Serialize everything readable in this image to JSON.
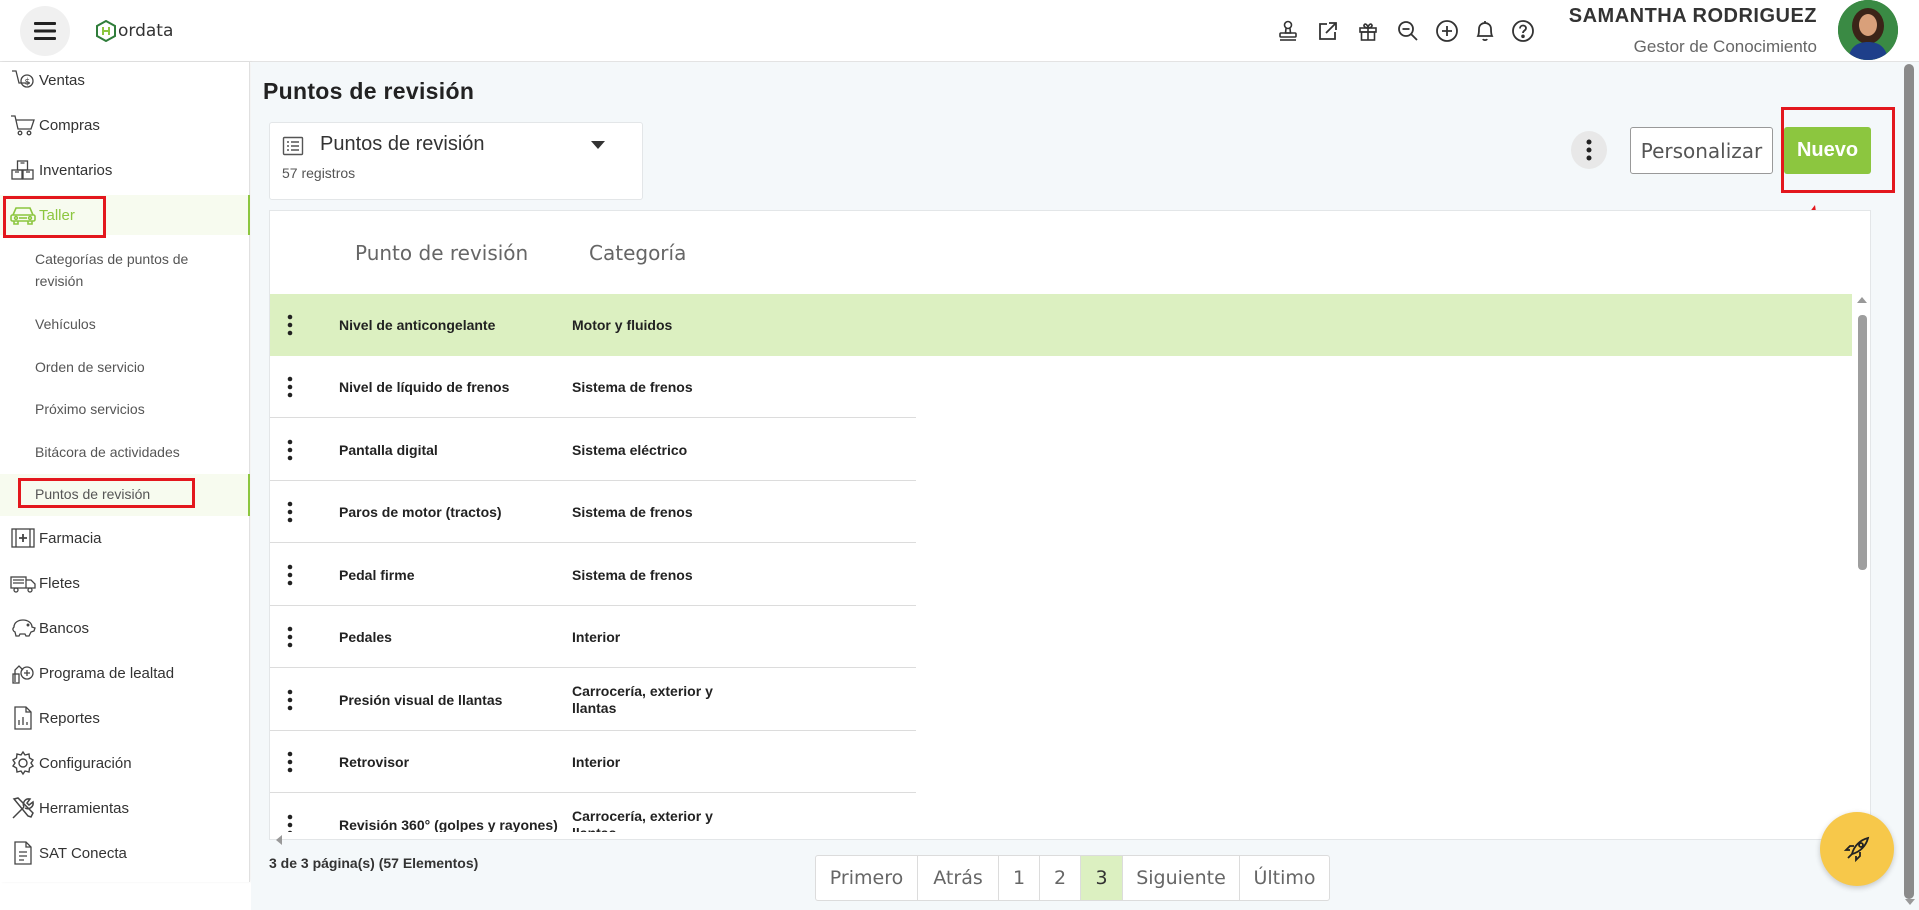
{
  "header": {
    "logo_text": "ordata",
    "user_name": "SAMANTHA RODRIGUEZ",
    "user_role": "Gestor de Conocimiento",
    "icons": [
      "stamp-icon",
      "external-link-icon",
      "gift-icon",
      "search-zoom-icon",
      "plus-circle-icon",
      "bell-icon",
      "help-icon"
    ]
  },
  "sidebar": {
    "items": [
      {
        "label": "Ventas",
        "icon": "sales-icon"
      },
      {
        "label": "Compras",
        "icon": "cart-icon"
      },
      {
        "label": "Inventarios",
        "icon": "boxes-icon"
      },
      {
        "label": "Taller",
        "icon": "car-icon"
      },
      {
        "label": "Farmacia",
        "icon": "pharmacy-icon"
      },
      {
        "label": "Fletes",
        "icon": "truck-icon"
      },
      {
        "label": "Bancos",
        "icon": "piggy-bank-icon"
      },
      {
        "label": "Programa de lealtad",
        "icon": "loyalty-icon"
      },
      {
        "label": "Reportes",
        "icon": "report-icon"
      },
      {
        "label": "Configuración",
        "icon": "gear-icon"
      },
      {
        "label": "Herramientas",
        "icon": "tools-icon"
      },
      {
        "label": "SAT Conecta",
        "icon": "document-icon"
      }
    ],
    "subitems": [
      "Categorías de puntos de revisión",
      "Vehículos",
      "Orden de servicio",
      "Próximo servicios",
      "Bitácora de actividades",
      "Puntos de revisión"
    ],
    "active_color": "#8cc63f"
  },
  "main": {
    "title": "Puntos de revisión",
    "view_name": "Puntos de revisión",
    "record_count": "57 registros",
    "btn_customize": "Personalizar",
    "btn_new": "Nuevo",
    "columns": [
      "Punto de revisión",
      "Categoría"
    ],
    "rows": [
      {
        "point": "Nivel de anticongelante",
        "category": "Motor y fluidos"
      },
      {
        "point": "Nivel de líquido de frenos",
        "category": "Sistema de frenos"
      },
      {
        "point": "Pantalla digital",
        "category": "Sistema eléctrico"
      },
      {
        "point": "Paros de motor (tractos)",
        "category": "Sistema de frenos"
      },
      {
        "point": "Pedal firme",
        "category": "Sistema de frenos"
      },
      {
        "point": "Pedales",
        "category": "Interior"
      },
      {
        "point": "Presión visual de llantas",
        "category": "Carrocería, exterior y llantas"
      },
      {
        "point": "Retrovisor",
        "category": "Interior"
      },
      {
        "point": "Revisión 360° (golpes y rayones)",
        "category": "Carrocería, exterior y llantas"
      }
    ],
    "footer_info": "3 de 3 página(s) (57 Elementos)",
    "pager": [
      "Primero",
      "Atrás",
      "1",
      "2",
      "3",
      "Siguiente",
      "Último"
    ],
    "current_page": "3"
  },
  "colors": {
    "accent": "#8cc63f",
    "selected_row": "#dcf0c1",
    "annotation_red": "#e3171d",
    "fab": "#f7c84a"
  }
}
